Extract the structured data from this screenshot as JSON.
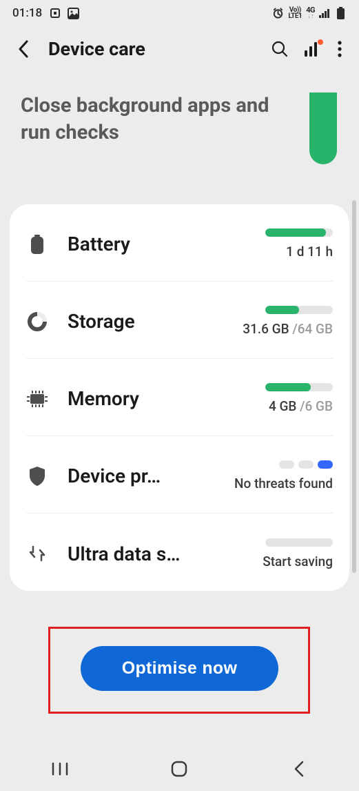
{
  "status_bar": {
    "time": "01:18",
    "net_label_top": "Vo))",
    "net_label_bot": "LTE1",
    "net_gen": "4G"
  },
  "app_bar": {
    "title": "Device care"
  },
  "summary": {
    "text": "Close background apps and run checks"
  },
  "rows": {
    "battery": {
      "label": "Battery",
      "sub": "1 d 11 h",
      "fill_pct": 90
    },
    "storage": {
      "label": "Storage",
      "used": "31.6 GB ",
      "total": "/64 GB",
      "fill_pct": 50
    },
    "memory": {
      "label": "Memory",
      "used": "4 GB ",
      "total": "/6 GB",
      "fill_pct": 67
    },
    "device_protection": {
      "label": "Device pr…",
      "sub": "No threats found"
    },
    "ultra_data": {
      "label": "Ultra data s…",
      "sub": "Start saving",
      "fill_pct": 0
    }
  },
  "optimise_button": "Optimise now"
}
